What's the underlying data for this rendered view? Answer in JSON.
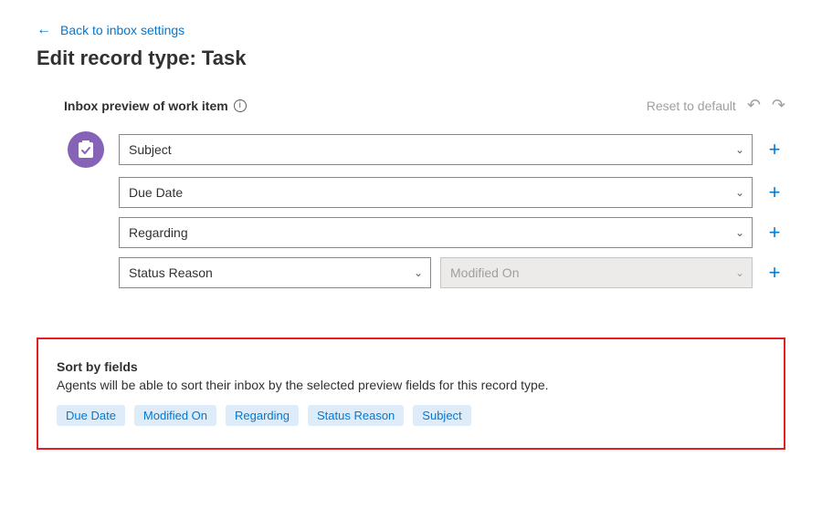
{
  "back_link": "Back to inbox settings",
  "page_title": "Edit record type: Task",
  "preview": {
    "label": "Inbox preview of work item",
    "reset_label": "Reset to default",
    "rows": [
      {
        "value": "Subject"
      },
      {
        "value": "Due Date"
      },
      {
        "value": "Regarding"
      },
      {
        "value": "Status Reason",
        "second_value": "Modified On",
        "second_disabled": true
      }
    ]
  },
  "sort": {
    "title": "Sort by fields",
    "description": "Agents will be able to sort their inbox by the selected preview fields for this record type.",
    "tags": [
      "Due Date",
      "Modified On",
      "Regarding",
      "Status Reason",
      "Subject"
    ]
  }
}
